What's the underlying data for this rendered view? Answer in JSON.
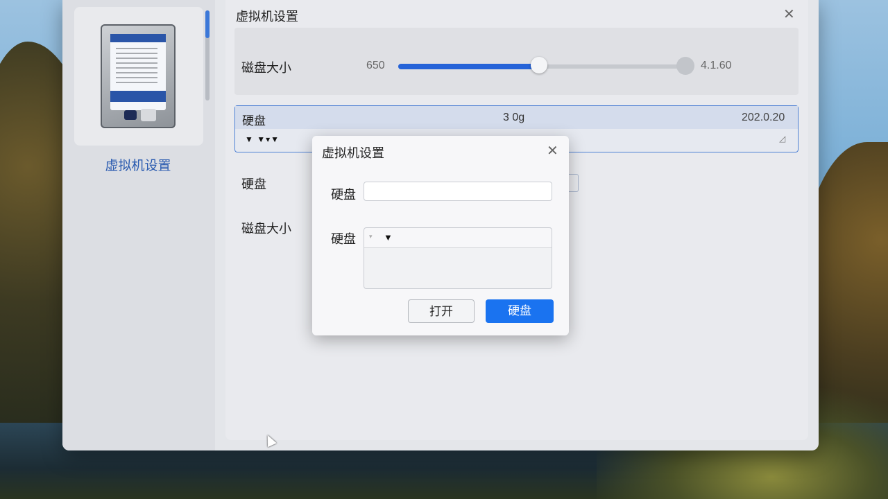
{
  "sidebar": {
    "title": "虚拟机设置"
  },
  "content": {
    "title": "虚拟机设置",
    "close_icon": "close-icon",
    "slider": {
      "label": "磁盘大小",
      "min_label": "650",
      "max_label": "4.1.60",
      "value_fraction": 0.49,
      "accent": "#2563d8"
    },
    "disk_row": {
      "name": "硬盘",
      "size": "3 0g",
      "date": "202.0.20",
      "arrows": "▼ ▼▾▼",
      "corner": "◿"
    },
    "field_1_label": "硬盘",
    "field_2_label": "磁盘大小"
  },
  "dialog": {
    "title": "虚拟机设置",
    "close_icon": "close-icon",
    "field_1_label": "硬盘",
    "field_1_value": "",
    "field_2_label": "硬盘",
    "select_caret_small": "▾",
    "select_caret": "▼",
    "open_button": "打开",
    "confirm_button": "硬盘",
    "confirm_color": "#1a73f0"
  }
}
